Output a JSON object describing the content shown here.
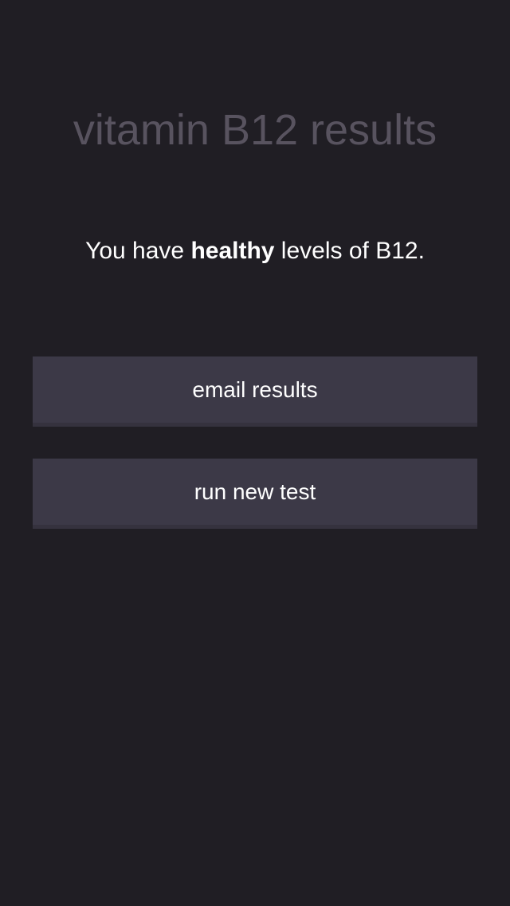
{
  "header": {
    "title": "vitamin B12 results"
  },
  "result": {
    "prefix": "You have ",
    "status": "healthy",
    "suffix": " levels of B12."
  },
  "actions": {
    "email_label": "email results",
    "new_test_label": "run new test"
  },
  "colors": {
    "background": "#201e24",
    "title": "#58535f",
    "button": "#3c3947",
    "text": "#ffffff"
  }
}
